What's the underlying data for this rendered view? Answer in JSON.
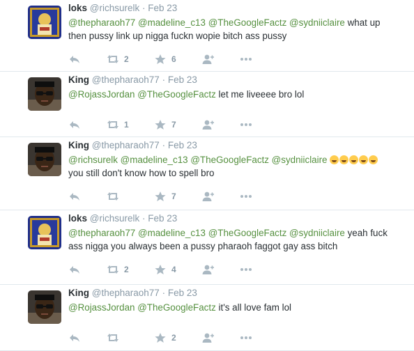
{
  "tweets": [
    {
      "name": "loks",
      "handle": "@richsurelk",
      "dot": "·",
      "time": "Feb 23",
      "avatar": "loks",
      "line1": [
        {
          "t": "@thepharaoh77",
          "m": true
        },
        {
          "t": " ",
          "m": false
        },
        {
          "t": "@madeline_c13",
          "m": true
        },
        {
          "t": " ",
          "m": false
        },
        {
          "t": "@TheGoogleFactz",
          "m": true
        },
        {
          "t": " ",
          "m": false
        },
        {
          "t": "@sydniiclaire",
          "m": true
        },
        {
          "t": " what up",
          "m": false
        }
      ],
      "line2": "then pussy link up nigga fuckn wopie bitch ass pussy",
      "retweets": "2",
      "favorites": "6"
    },
    {
      "name": "King",
      "handle": "@thepharaoh77",
      "dot": "·",
      "time": "Feb 23",
      "avatar": "king",
      "line1": [
        {
          "t": "@RojassJordan",
          "m": true
        },
        {
          "t": " ",
          "m": false
        },
        {
          "t": "@TheGoogleFactz",
          "m": true
        },
        {
          "t": " let me liveeee bro lol",
          "m": false
        }
      ],
      "line2": "",
      "retweets": "1",
      "favorites": "7"
    },
    {
      "name": "King",
      "handle": "@thepharaoh77",
      "dot": "·",
      "time": "Feb 23",
      "avatar": "king",
      "line1": [
        {
          "t": "@richsurelk",
          "m": true
        },
        {
          "t": " ",
          "m": false
        },
        {
          "t": "@madeline_c13",
          "m": true
        },
        {
          "t": " ",
          "m": false
        },
        {
          "t": "@TheGoogleFactz",
          "m": true
        },
        {
          "t": " ",
          "m": false
        },
        {
          "t": "@sydniiclaire",
          "m": true
        },
        {
          "t": " ",
          "m": false
        }
      ],
      "emoji_count": 5,
      "line2": "you still don't know how to spell bro",
      "retweets": "",
      "favorites": "7"
    },
    {
      "name": "loks",
      "handle": "@richsurelk",
      "dot": "·",
      "time": "Feb 23",
      "avatar": "loks",
      "line1": [
        {
          "t": "@thepharaoh77",
          "m": true
        },
        {
          "t": " ",
          "m": false
        },
        {
          "t": "@madeline_c13",
          "m": true
        },
        {
          "t": " ",
          "m": false
        },
        {
          "t": "@TheGoogleFactz",
          "m": true
        },
        {
          "t": " ",
          "m": false
        },
        {
          "t": "@sydniiclaire",
          "m": true
        },
        {
          "t": " yeah fuck",
          "m": false
        }
      ],
      "line2": "ass nigga you always been a pussy pharaoh faggot gay ass bitch",
      "retweets": "2",
      "favorites": "4"
    },
    {
      "name": "King",
      "handle": "@thepharaoh77",
      "dot": "·",
      "time": "Feb 23",
      "avatar": "king",
      "line1": [
        {
          "t": "@RojassJordan",
          "m": true
        },
        {
          "t": " ",
          "m": false
        },
        {
          "t": "@TheGoogleFactz",
          "m": true
        },
        {
          "t": " it's all love fam lol",
          "m": false
        }
      ],
      "line2": "",
      "retweets": "",
      "favorites": "2"
    }
  ],
  "icons": {
    "reply": "reply-icon",
    "retweet": "retweet-icon",
    "favorite": "star-icon",
    "follow": "follow-icon",
    "more": "more-icon"
  },
  "colors": {
    "mention": "#55903f",
    "icon": "#aab8c2",
    "meta": "#8899a6",
    "border": "#e1e8ed"
  }
}
